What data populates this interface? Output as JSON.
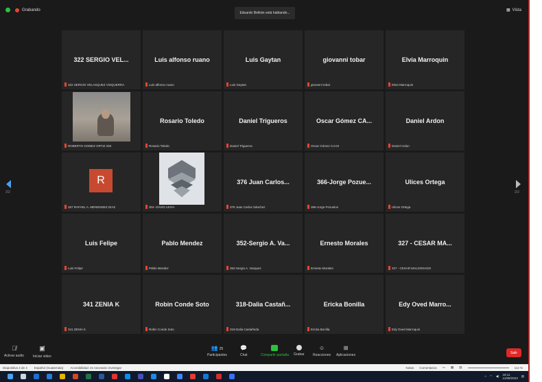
{
  "topbar": {
    "recording_label": "Grabando",
    "speaking_text": "Eduardo Beltrán está hablando...",
    "view_label": "Vista"
  },
  "nav": {
    "page_left": "2/2",
    "page_right": "2/2"
  },
  "tiles": [
    {
      "name": "322 SERGIO VEL...",
      "label": "322 SERGIO VELASQUEZ VISQUERRA"
    },
    {
      "name": "Luis alfonso ruano",
      "label": "Luis alfonso ruano"
    },
    {
      "name": "Luis Gaytan",
      "label": "Luis Gaytan"
    },
    {
      "name": "giovanni tobar",
      "label": "giovanni tobar"
    },
    {
      "name": "Elvia Marroquin",
      "label": "Elvia Marroquin"
    },
    {
      "name": "",
      "label": "ROBERTO GOMEZ ORTIZ 260"
    },
    {
      "name": "Rosario Toledo",
      "label": "Rosario Toledo"
    },
    {
      "name": "Daniel Trigueros",
      "label": "Daniel Trigueros"
    },
    {
      "name": "Oscar Gómez CA...",
      "label": "Oscar Gómez CAAS"
    },
    {
      "name": "Daniel  Ardon",
      "label": "Daniel  Ardon"
    },
    {
      "name": "",
      "label": "267 RAFAEL A. MENENDEZ DIAZ",
      "avatar_letter": "R"
    },
    {
      "name": "",
      "label": "304- DAVID LEIVA"
    },
    {
      "name": "376 Juan Carlos...",
      "label": "376 Juan Carlos Sánchez"
    },
    {
      "name": "366-Jorge Pozue...",
      "label": "366-Jorge Pozuelos"
    },
    {
      "name": "Ulices Ortega",
      "label": "Ulices Ortega"
    },
    {
      "name": "Luis Felipe",
      "label": "Luis Felipe"
    },
    {
      "name": "Pablo Mendez",
      "label": "Pablo Mendez"
    },
    {
      "name": "352-Sergio A. Va...",
      "label": "352-Sergio A. Vasquez"
    },
    {
      "name": "Ernesto Morales",
      "label": "Ernesto Morales"
    },
    {
      "name": "327 - CESAR MA...",
      "label": "327 - CESAR MALDONADO"
    },
    {
      "name": "341 ZENIA K",
      "label": "341 ZENIA K"
    },
    {
      "name": "Robin Conde Soto",
      "label": "Robin Conde Soto"
    },
    {
      "name": "318-Dalia Castañ...",
      "label": "318-Dalia Castañeda"
    },
    {
      "name": "Ericka Bonilla",
      "label": "Ericka Bonilla"
    },
    {
      "name": "Edy Oved Marro...",
      "label": "Edy Oved Marroquin"
    }
  ],
  "toolbar": {
    "audio": "Activar audio",
    "video": "Iniciar video",
    "participants": "Participantes",
    "participants_count": "25",
    "chat": "Chat",
    "share": "Compartir pantalla",
    "record": "Grabar",
    "reactions": "Reacciones",
    "apps": "Aplicaciones",
    "leave": "Salir"
  },
  "statusbar": {
    "slide": "Diapositiva 4 de 4",
    "language": "Español (Guatemala)",
    "accessibility": "Accesibilidad: es necesario investigar",
    "notes": "Notas",
    "comments": "Comentarios",
    "zoom": "114 %"
  },
  "taskbar": {
    "time": "18:11",
    "date": "11/08/2023"
  },
  "colors": {
    "accent_green": "#2fbf3f",
    "share_green": "#2fbf3f",
    "leave_red": "#e02828",
    "mute_red": "#e8442e"
  }
}
